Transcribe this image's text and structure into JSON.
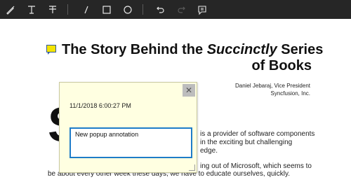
{
  "toolbar": {
    "tools": [
      {
        "icon": "ink-pen-icon"
      },
      {
        "icon": "text-markup-icon"
      },
      {
        "icon": "strikethrough-icon"
      },
      {
        "icon": "line-icon"
      },
      {
        "icon": "rectangle-icon"
      },
      {
        "icon": "ellipse-icon"
      },
      {
        "icon": "undo-icon"
      },
      {
        "icon": "redo-icon"
      },
      {
        "icon": "popup-note-icon"
      }
    ]
  },
  "document": {
    "title_pre": "The Story Behind the ",
    "title_italic": "Succinctly",
    "title_post": " Series",
    "title_line2": "of Books",
    "author_line1": "Daniel Jebaraj, Vice President",
    "author_line2": "Syncfusion, Inc.",
    "drop_cap": "S",
    "body_line1": "is a provider of software components",
    "body_line2": "in the exciting but challenging",
    "body_line3": "edge.",
    "body_line4": "ing out of Microsoft, which seems to",
    "body_line5": "be about every other week these days, we have to educate ourselves, quickly."
  },
  "popup": {
    "close_label": "✕",
    "date": "11/1/2018 6:00:27 PM",
    "text": "New popup annotation"
  },
  "colors": {
    "toolbar_bg": "#262626",
    "popup_bg": "#ffffe1",
    "focus_border": "#1e7cc8",
    "note_icon": "#f4e400"
  }
}
